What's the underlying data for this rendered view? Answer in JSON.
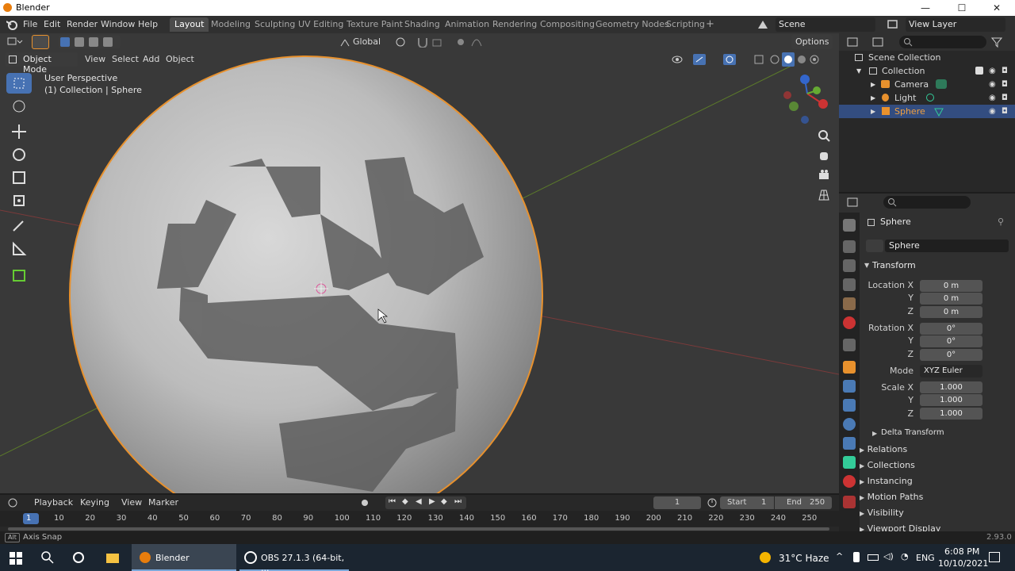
{
  "window": {
    "title": "Blender",
    "min": "—",
    "max": "☐",
    "close": "✕"
  },
  "menu": [
    "File",
    "Edit",
    "Render",
    "Window",
    "Help"
  ],
  "workspaces": [
    "Layout",
    "Modeling",
    "Sculpting",
    "UV Editing",
    "Texture Paint",
    "Shading",
    "Animation",
    "Rendering",
    "Compositing",
    "Geometry Nodes",
    "Scripting"
  ],
  "scene": {
    "name": "Scene",
    "view_layer": "View Layer"
  },
  "toolbar": {
    "orientation": "Global",
    "options": "Options"
  },
  "viewport": {
    "mode": "Object Mode",
    "menus": [
      "View",
      "Select",
      "Add",
      "Object"
    ],
    "perspective": "User Perspective",
    "context": "(1) Collection | Sphere"
  },
  "outliner": {
    "root": "Scene Collection",
    "collection": "Collection",
    "items": [
      "Camera",
      "Light",
      "Sphere"
    ]
  },
  "properties": {
    "object_name": "Sphere",
    "data_name": "Sphere",
    "transform_title": "Transform",
    "location": {
      "label": "Location X",
      "x": "0 m",
      "y": "0 m",
      "z": "0 m"
    },
    "rotation": {
      "label": "Rotation X",
      "x": "0°",
      "y": "0°",
      "z": "0°"
    },
    "mode": {
      "label": "Mode",
      "value": "XYZ Euler"
    },
    "scale": {
      "label": "Scale X",
      "x": "1.000",
      "y": "1.000",
      "z": "1.000"
    },
    "axis_y": "Y",
    "axis_z": "Z",
    "delta": "Delta Transform",
    "panels": [
      "Relations",
      "Collections",
      "Instancing",
      "Motion Paths",
      "Visibility",
      "Viewport Display"
    ]
  },
  "timeline": {
    "menus": [
      "Playback",
      "Keying",
      "View",
      "Marker"
    ],
    "current_frame": "1",
    "start_label": "Start",
    "start": "1",
    "end_label": "End",
    "end": "250",
    "ruler": [
      "1",
      "10",
      "20",
      "30",
      "40",
      "50",
      "60",
      "70",
      "80",
      "90",
      "100",
      "110",
      "120",
      "130",
      "140",
      "150",
      "160",
      "170",
      "180",
      "190",
      "200",
      "210",
      "220",
      "230",
      "240",
      "250"
    ]
  },
  "status": {
    "key": "Alt",
    "hint": "Axis Snap",
    "version": "2.93.0"
  },
  "taskbar": {
    "blender": "Blender",
    "obs": "OBS 27.1.3 (64-bit, ...",
    "weather": "31°C Haze",
    "lang": "ENG",
    "time": "6:08 PM",
    "date": "10/10/2021"
  },
  "colors": {
    "accent": "#4772b3",
    "selection": "#e8912d",
    "background": "#393939"
  }
}
